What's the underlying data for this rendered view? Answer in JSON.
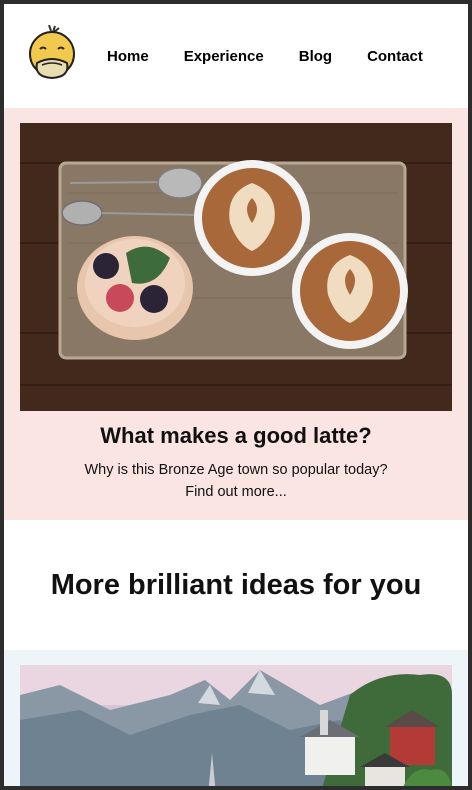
{
  "nav": {
    "items": [
      {
        "label": "Home"
      },
      {
        "label": "Experience"
      },
      {
        "label": "Blog"
      },
      {
        "label": "Contact"
      }
    ]
  },
  "featured": {
    "title": "What makes a good latte?",
    "description": "Why is this Bronze Age town so popular today?",
    "link_text": "Find out more..."
  },
  "more": {
    "heading": "More brilliant ideas for you"
  },
  "colors": {
    "featured_bg": "#fbe5e3",
    "card2_bg": "#eef5f9",
    "logo_yellow": "#f2c94c"
  },
  "icons": {
    "logo": "duck-logo-icon"
  }
}
